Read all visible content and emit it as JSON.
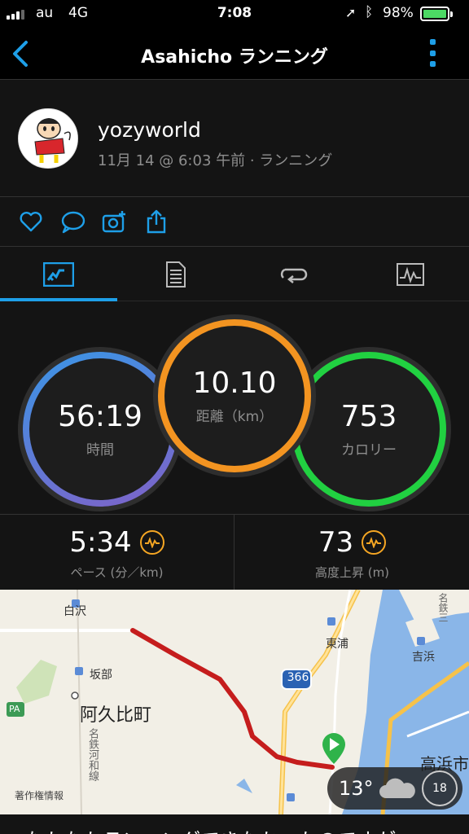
{
  "status_bar": {
    "carrier": "au",
    "network": "4G",
    "time": "7:08",
    "battery": "98%"
  },
  "nav": {
    "title": "Asahicho ランニング"
  },
  "profile": {
    "username": "yozyworld",
    "meta": "11月 14 @ 6:03 午前 · ランニング"
  },
  "actions": [
    "heart-icon",
    "comment-icon",
    "camera-icon",
    "share-icon"
  ],
  "tabs": [
    "summary-tab",
    "details-tab",
    "laps-tab",
    "charts-tab"
  ],
  "rings": {
    "time": {
      "value": "56:19",
      "label": "時間",
      "colors": [
        "#3a96e6",
        "#7f62c8"
      ]
    },
    "distance": {
      "value": "10.10",
      "label": "距離（km）",
      "color": "#f39421"
    },
    "calories": {
      "value": "753",
      "label": "カロリー",
      "color": "#21d141"
    }
  },
  "stats": {
    "pace": {
      "value": "5:34",
      "label": "ペース (分／km)"
    },
    "elevation": {
      "value": "73",
      "label": "高度上昇 (m)"
    }
  },
  "map": {
    "labels": {
      "shirasawa": "白沢",
      "sakabe": "坂部",
      "akuhi": "阿久比町",
      "pa": "PA",
      "road_name": "名鉄河和線",
      "higashiura": "東浦",
      "route_no": "366",
      "yoshihama": "吉浜",
      "takahama": "高浜市",
      "meitetsu": "名鉄三",
      "copyright": "著作権情報"
    },
    "weather": {
      "temp": "13°",
      "wind": "18"
    }
  },
  "bottom_text": "なかなかランニングできなかったのですが"
}
